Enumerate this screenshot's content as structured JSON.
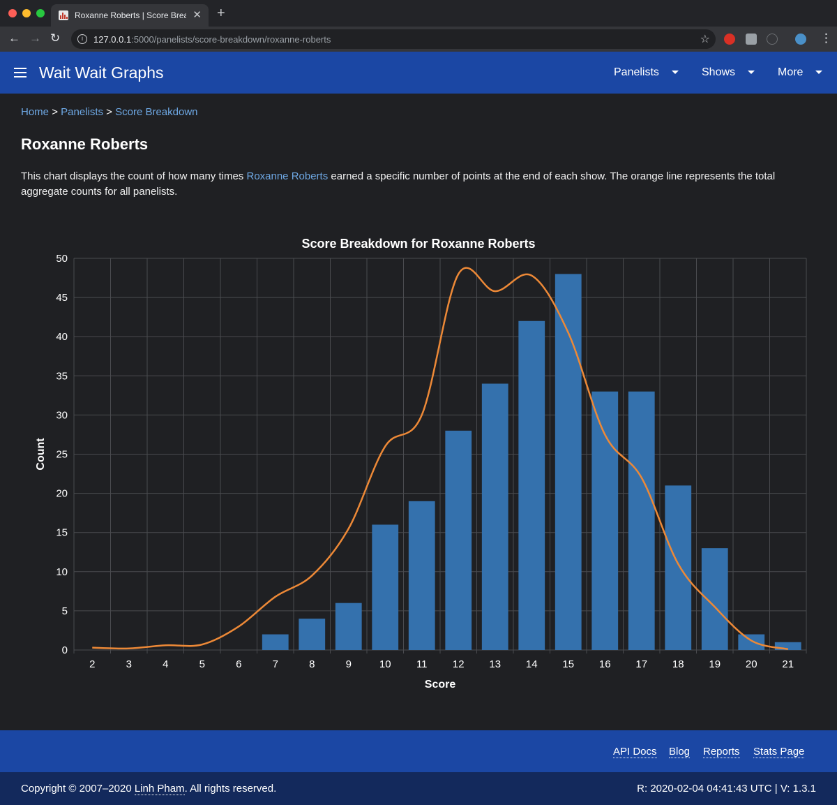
{
  "browser": {
    "tab_title": "Roxanne Roberts | Score Breakdown",
    "url_host": "127.0.0.1",
    "url_path": ":5000/panelists/score-breakdown/roxanne-roberts"
  },
  "header": {
    "title": "Wait Wait Graphs",
    "menus": [
      "Panelists",
      "Shows",
      "More"
    ]
  },
  "breadcrumb": {
    "items": [
      "Home",
      "Panelists",
      "Score Breakdown"
    ],
    "separator": ">"
  },
  "page": {
    "title": "Roxanne Roberts",
    "description_before": "This chart displays the count of how many times ",
    "description_link": "Roxanne Roberts",
    "description_after": " earned a specific number of points at the end of each show. The orange line represents the total aggregate counts for all panelists."
  },
  "chart_data": {
    "type": "bar",
    "title": "Score Breakdown for Roxanne Roberts",
    "xlabel": "Score",
    "ylabel": "Count",
    "categories": [
      "2",
      "3",
      "4",
      "5",
      "6",
      "7",
      "8",
      "9",
      "10",
      "11",
      "12",
      "13",
      "14",
      "15",
      "16",
      "17",
      "18",
      "19",
      "20",
      "21"
    ],
    "ylim": [
      0,
      50
    ],
    "yticks": [
      0,
      5,
      10,
      15,
      20,
      25,
      30,
      35,
      40,
      45,
      50
    ],
    "grid": true,
    "series": [
      {
        "type": "bar",
        "values": [
          0,
          0,
          0,
          0,
          0,
          2,
          4,
          6,
          16,
          19,
          28,
          34,
          42,
          48,
          33,
          33,
          21,
          13,
          2,
          1
        ],
        "color": "#3471ad"
      },
      {
        "type": "line",
        "values": [
          0.3,
          0.2,
          0.6,
          0.7,
          3,
          6.8,
          9.5,
          15.5,
          26,
          30,
          48,
          45.8,
          47.8,
          40.5,
          27.5,
          22,
          11,
          5.5,
          1.2,
          0.1
        ],
        "color": "#ed8937"
      }
    ]
  },
  "footer": {
    "links": [
      "API Docs",
      "Blog",
      "Reports",
      "Stats Page"
    ],
    "copyright_before": "Copyright © 2007–2020 ",
    "copyright_link": "Linh Pham",
    "copyright_after": ". All rights reserved.",
    "version": "R: 2020-02-04 04:41:43 UTC | V: 1.3.1"
  }
}
